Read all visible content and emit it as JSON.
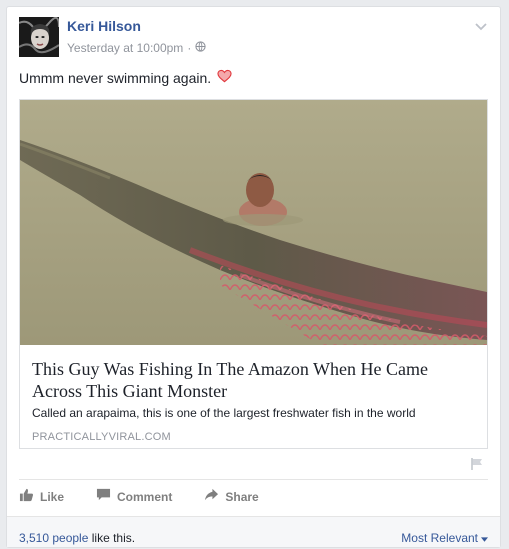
{
  "post": {
    "author": "Keri Hilson",
    "timestamp": "Yesterday at 10:00pm",
    "separator": "·",
    "privacy_icon": "globe-icon",
    "text": "Ummm never swimming again.",
    "emoji_icon": "heart-icon"
  },
  "link": {
    "headline": "This Guy Was Fishing In The Amazon When He Came Across This Giant Monster",
    "description": "Called an arapaima, this is one of the largest freshwater fish in the world",
    "domain": "PRACTICALLYVIRAL.COM"
  },
  "actions": {
    "like": "Like",
    "comment": "Comment",
    "share": "Share"
  },
  "footer": {
    "likes_count": "3,510 people",
    "likes_suffix": " like this.",
    "sort": "Most Relevant"
  },
  "colors": {
    "link_blue": "#365899",
    "meta_gray": "#90949c",
    "heart_red": "#e0393e"
  }
}
